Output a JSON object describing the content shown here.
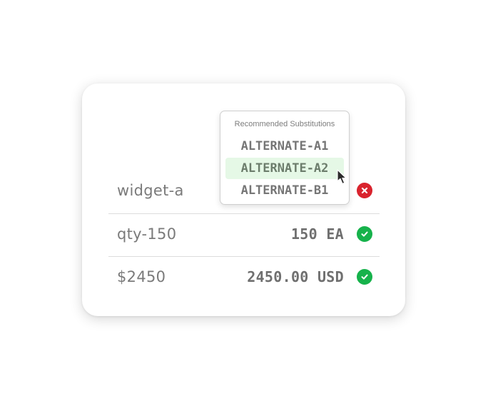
{
  "rows": [
    {
      "label": "widget-a",
      "value": "",
      "status": "error",
      "status_icon": "x-icon"
    },
    {
      "label": "qty-150",
      "value": "150 EA",
      "status": "ok",
      "status_icon": "check-icon"
    },
    {
      "label": "$2450",
      "value": "2450.00 USD",
      "status": "ok",
      "status_icon": "check-icon"
    }
  ],
  "dropdown": {
    "header": "Recommended Substitutions",
    "options": [
      "ALTERNATE-A1",
      "ALTERNATE-A2",
      "ALTERNATE-B1"
    ],
    "selected_option": "ALTERNATE-A2"
  },
  "colors": {
    "ok": "#16b24b",
    "error": "#d9232d",
    "selected_bg": "#e5f8e6"
  }
}
